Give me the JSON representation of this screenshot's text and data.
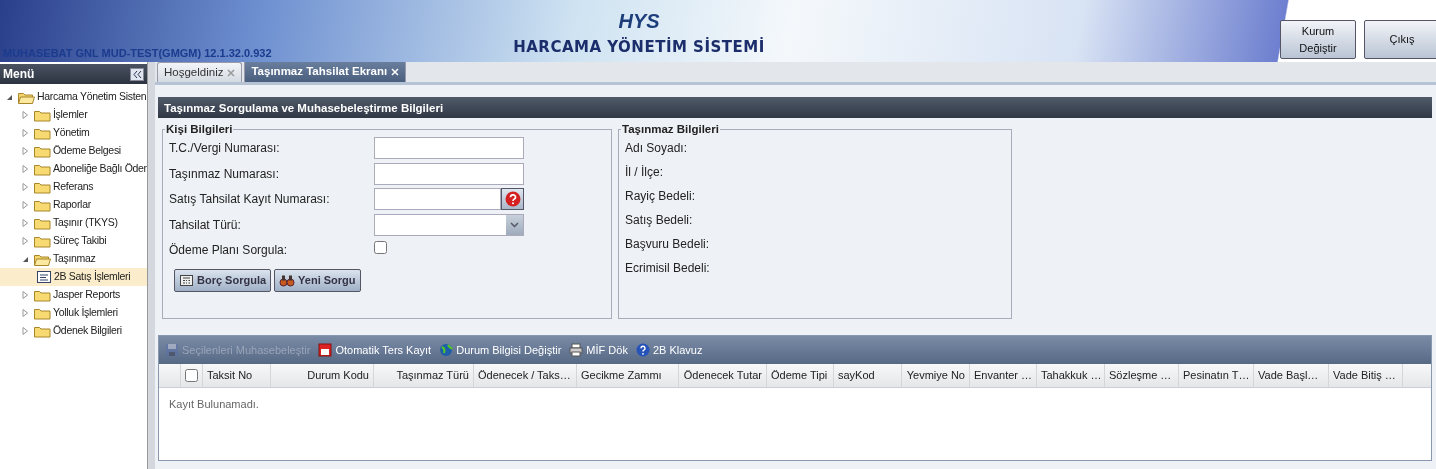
{
  "header": {
    "logo": "HYS",
    "app_title": "HARCAMA YÖNETİM SİSTEMİ",
    "org_version": "MUHASEBAT GNL MUD-TEST(GMGM) 12.1.32.0.932",
    "buttons": [
      "Kurum Değiştir",
      "Çıkış"
    ]
  },
  "sidebar": {
    "title": "Menü",
    "tree": [
      {
        "label": "Harcama Yönetim Sisten",
        "kind": "folder",
        "expanded": true,
        "selected": false,
        "children": [
          {
            "label": "İşlemler",
            "kind": "folder",
            "expanded": false,
            "selected": false
          },
          {
            "label": "Yönetim",
            "kind": "folder",
            "expanded": false,
            "selected": false
          },
          {
            "label": "Ödeme Belgesi",
            "kind": "folder",
            "expanded": false,
            "selected": false
          },
          {
            "label": "Aboneliğe Bağlı Öder",
            "kind": "folder",
            "expanded": false,
            "selected": false
          },
          {
            "label": "Referans",
            "kind": "folder",
            "expanded": false,
            "selected": false
          },
          {
            "label": "Raporlar",
            "kind": "folder",
            "expanded": false,
            "selected": false
          },
          {
            "label": "Taşınır (TKYS)",
            "kind": "folder",
            "expanded": false,
            "selected": false
          },
          {
            "label": "Süreç Takibi",
            "kind": "folder",
            "expanded": false,
            "selected": false
          },
          {
            "label": "Taşınmaz",
            "kind": "folder",
            "expanded": true,
            "selected": false,
            "children": [
              {
                "label": "2B Satış İşlemleri",
                "kind": "page",
                "selected": true
              }
            ]
          },
          {
            "label": "Jasper Reports",
            "kind": "folder",
            "expanded": false,
            "selected": false
          },
          {
            "label": "Yolluk İşlemleri",
            "kind": "folder",
            "expanded": false,
            "selected": false
          },
          {
            "label": "Ödenek Bilgileri",
            "kind": "folder",
            "expanded": false,
            "selected": false
          }
        ]
      }
    ]
  },
  "tabs": [
    {
      "label": "Hoşgeldiniz",
      "selected": false
    },
    {
      "label": "Taşınmaz Tahsilat Ekranı",
      "selected": true
    }
  ],
  "panel_title": "Taşınmaz Sorgulama ve Muhasebeleştirme Bilgileri",
  "person_info": {
    "legend": "Kişi Bilgileri",
    "fields": [
      {
        "label": "T.C./Vergi Numarası:",
        "kind": "text"
      },
      {
        "label": "Taşınmaz Numarası:",
        "kind": "text"
      },
      {
        "label": "Satış Tahsilat Kayıt Numarası:",
        "kind": "help"
      },
      {
        "label": "Tahsilat Türü:",
        "kind": "select"
      },
      {
        "label": "Ödeme Planı Sorgula:",
        "kind": "checkbox",
        "checked": false
      }
    ],
    "buttons": [
      {
        "label": "Borç Sorgula",
        "kind": "calc"
      },
      {
        "label": "Yeni Sorgu",
        "kind": "binoculars"
      }
    ]
  },
  "property_info": {
    "legend": "Taşınmaz Bilgileri",
    "labels": [
      "Adı Soyadı:",
      "İl / İlçe:",
      "Rayiç Bedeli:",
      "Satış Bedeli:",
      "Başvuru Bedeli:",
      "Ecrimisil Bedeli:"
    ]
  },
  "grid": {
    "toolbar": [
      {
        "label": "Seçilenleri Muhasebeleştir",
        "kind": "save",
        "disabled": true
      },
      {
        "label": "Otomatik Ters Kayıt",
        "kind": "undo",
        "disabled": false
      },
      {
        "label": "Durum Bilgisi Değiştir",
        "kind": "globe",
        "disabled": false
      },
      {
        "label": "MİF Dök",
        "kind": "print",
        "disabled": false
      },
      {
        "label": "2B Klavuz",
        "kind": "help",
        "disabled": false
      }
    ],
    "select_all_checked": false,
    "columns": [
      "Taksit No",
      "Durum Kodu",
      "Taşınmaz Türü",
      "Ödenecek / Taks…",
      "Gecikme Zammı",
      "Ödenecek Tutar",
      "Ödeme Tipi",
      "sayKod",
      "Yevmiye No",
      "Envanter …",
      "Tahakkuk …",
      "Sözleşme …",
      "Pesinatın T…",
      "Vade Başl…",
      "Vade Bitiş …"
    ],
    "empty_text": "Kayıt Bulunamadı."
  }
}
